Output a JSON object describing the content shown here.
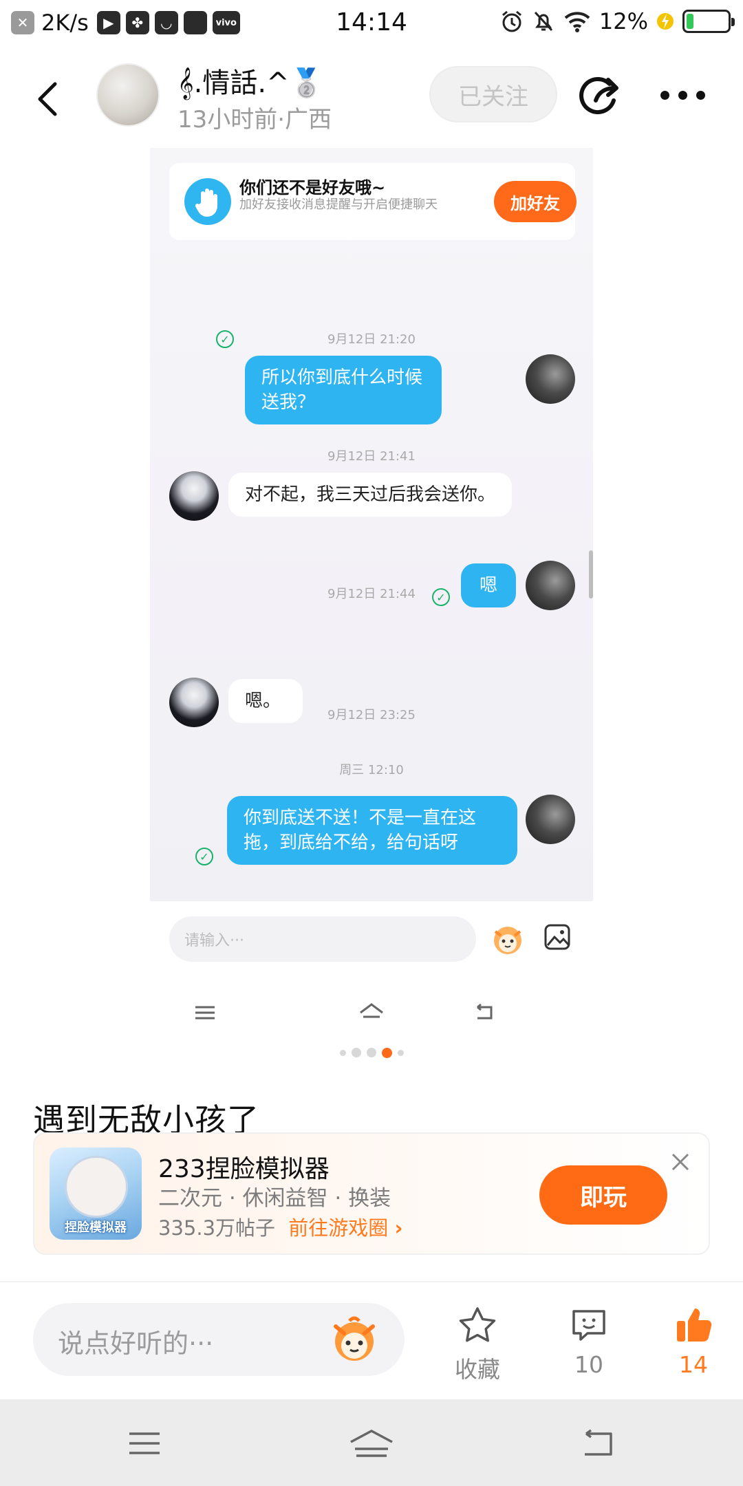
{
  "status_bar": {
    "net_speed": "2K/s",
    "time": "14:14",
    "battery": "12%"
  },
  "header": {
    "author": "𝄞.情話.^🥈",
    "meta": "13小时前·广西",
    "follow_label": "已关注"
  },
  "chat": {
    "friend_card": {
      "title": "你们还不是好友哦~",
      "subtitle": "加好友接收消息提醒与开启便捷聊天",
      "button": "加好友"
    },
    "messages": [
      {
        "time": "9月12日 21:20",
        "from": "me",
        "text": "所以你到底什么时候送我？"
      },
      {
        "time": "9月12日 21:41",
        "from": "them",
        "text": "对不起，我三天过后我会送你。"
      },
      {
        "time": "9月12日 21:44",
        "from": "me",
        "text": "嗯"
      },
      {
        "time": "9月12日 23:25",
        "from": "them",
        "text": "嗯。"
      },
      {
        "time": "周三 12:10",
        "from": "me",
        "text": "你到底送不送！不是一直在这拖，到底给不给，给句话呀"
      }
    ],
    "input_placeholder": "请输入···"
  },
  "carousel": {
    "count": 5,
    "active": 3
  },
  "post": {
    "title": "遇到无敌小孩了"
  },
  "game": {
    "name": "233捏脸模拟器",
    "tags": "二次元 · 休闲益智 · 换装",
    "posts": "335.3万帖子",
    "link": "前往游戏圈",
    "play": "即玩",
    "icon_text": "捏脸模拟器"
  },
  "actions": {
    "comment_placeholder": "说点好听的···",
    "favorite_label": "收藏",
    "comments_count": "10",
    "likes_count": "14"
  },
  "colors": {
    "accent": "#ff6a14",
    "chat_blue": "#2eb4f0",
    "follow_bg": "#f1f1f1"
  },
  "icons": [
    "back-icon",
    "share-icon",
    "more-icon",
    "hand-icon",
    "check-icon",
    "emoji-icon",
    "image-icon",
    "menu-icon",
    "home-icon",
    "return-icon",
    "close-icon",
    "star-icon",
    "comment-icon",
    "thumbs-up-icon"
  ]
}
